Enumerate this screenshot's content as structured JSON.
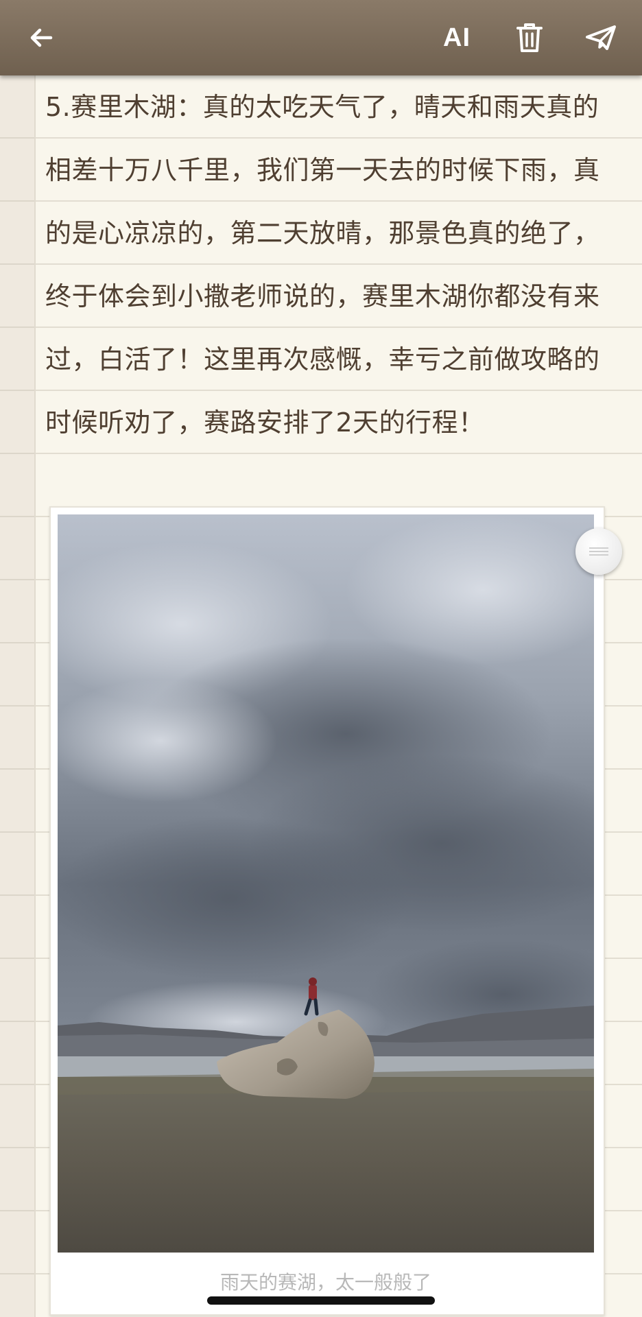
{
  "toolbar": {
    "back_icon": "arrow-left-icon",
    "ai_label": "AI",
    "delete_icon": "trash-icon",
    "send_icon": "paper-plane-icon"
  },
  "note": {
    "lines": [
      "5.赛里木湖：真的太吃天气了，晴天和雨天真的",
      "相差十万八千里，我们第一天去的时候下雨，真",
      "的是心凉凉的，第二天放晴，那景色真的绝了，",
      "终于体会到小撒老师说的，赛里木湖你都没有来",
      "过，白活了！这里再次感慨，幸亏之前做攻略的",
      "时候听劝了，赛路安排了2天的行程！"
    ]
  },
  "photo": {
    "caption": "雨天的赛湖，太一般般了"
  },
  "colors": {
    "toolbar": "#7a6a58",
    "text": "#4f3f31",
    "paper": "#f9f6ec"
  }
}
